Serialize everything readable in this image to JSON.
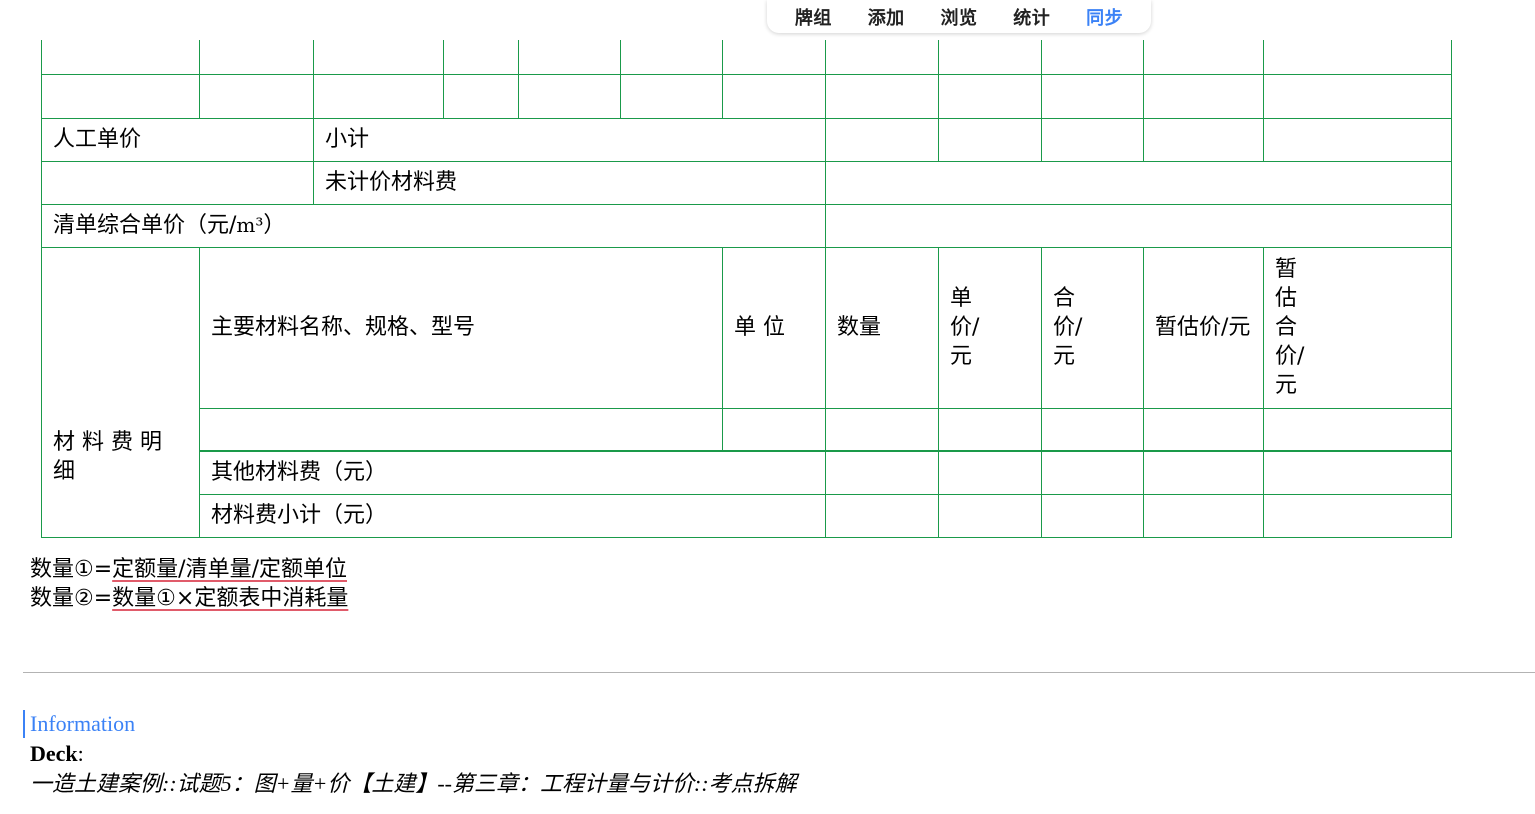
{
  "toolbar": {
    "items": [
      "牌组",
      "添加",
      "浏览",
      "统计",
      "同步"
    ],
    "active_color": "#3b82f6"
  },
  "table": {
    "labor_unit_price": "人工单价",
    "subtotal": "小计",
    "unpriced_material_fee": "未计价材料费",
    "bill_composite_unit_price": "清单综合单价（元/",
    "unit_m3": "m³",
    "close_paren": "）",
    "material_detail": "材 料 费 明 细",
    "material_header": {
      "name": "主要材料名称、规格、型号",
      "unit": "单 位",
      "quantity": "数量",
      "unit_price": "单价/元",
      "total_price": "合价/元",
      "est_unit_price": "暂估价/元",
      "est_total_price": "暂估合价/元"
    },
    "other_material_fee": "其他材料费（元）",
    "material_subtotal": "材料费小计（元）",
    "border_color": "#1a9a4a"
  },
  "notes": {
    "line1_prefix": "数量①=",
    "line1_formula": "定额量/清单量/定额单位",
    "line2_prefix": "数量②=",
    "line2_formula": "数量①×定额表中消耗量"
  },
  "info": {
    "heading": "Information",
    "deck_label": "Deck",
    "deck_colon": ":",
    "deck_value": "一造土建案例::试题5：图+量+价【土建】--第三章：工程计量与计价::考点拆解"
  }
}
